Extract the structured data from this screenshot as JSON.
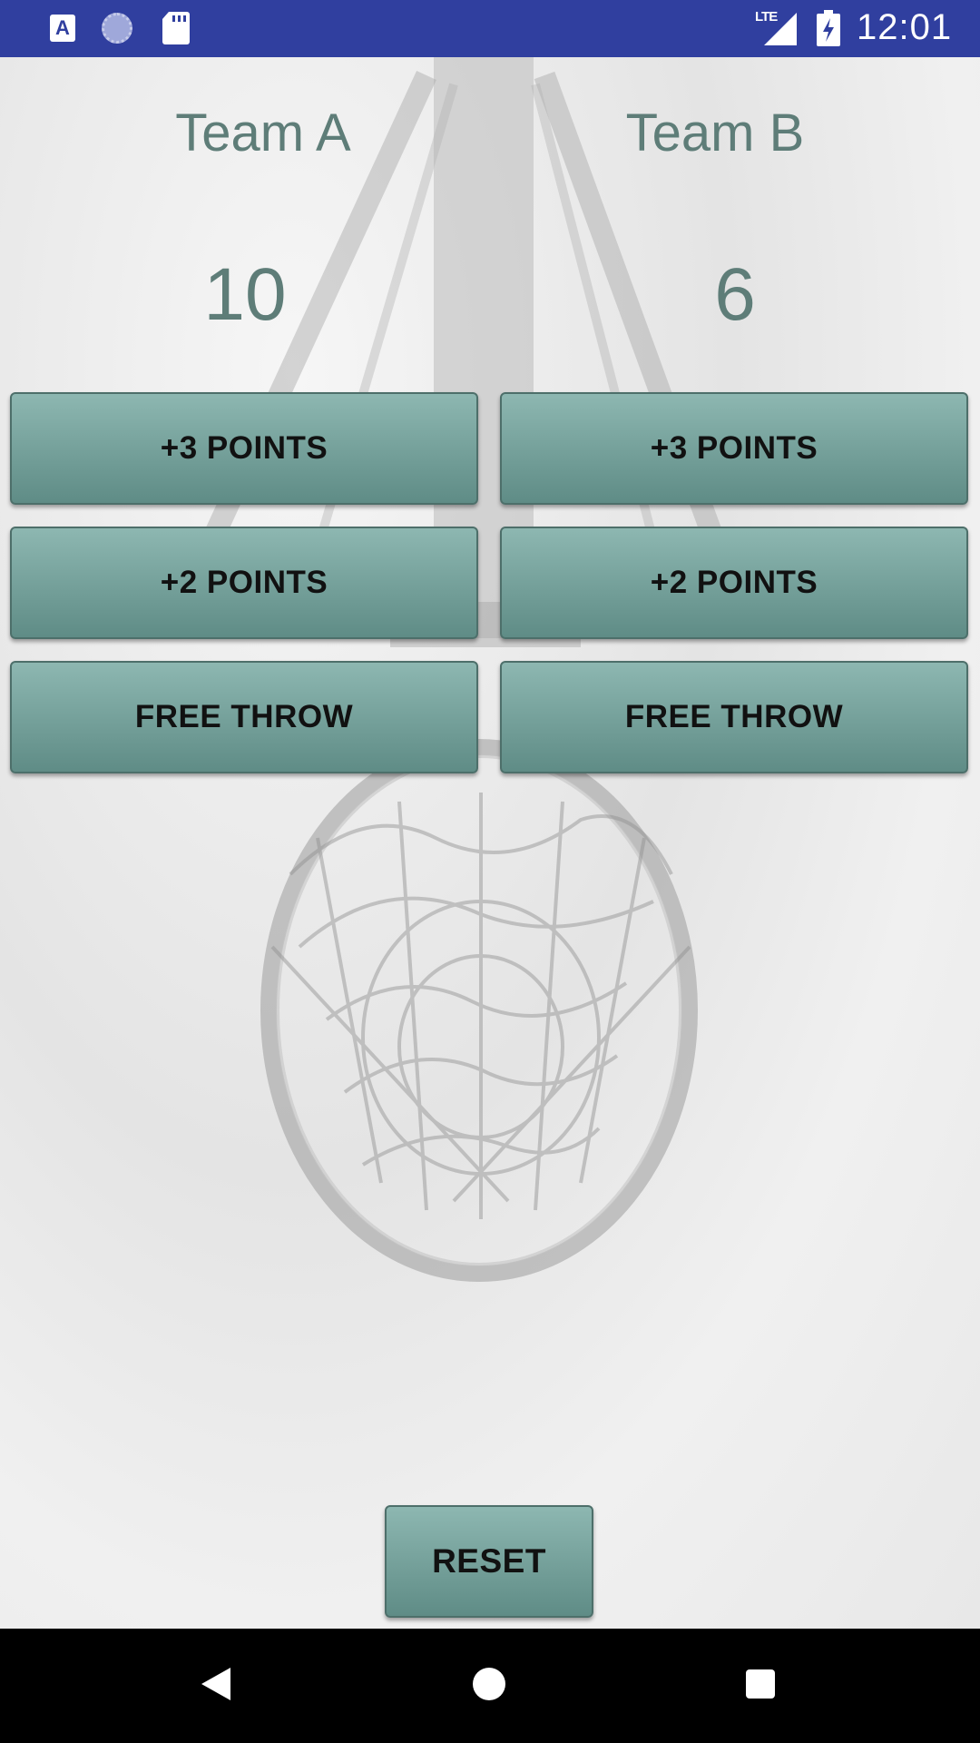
{
  "status_bar": {
    "time": "12:01",
    "network_label": "LTE",
    "notification_icons": [
      "app-a-icon",
      "sync-icon",
      "sd-card-icon"
    ],
    "system_icons": [
      "signal-icon",
      "battery-charging-icon"
    ],
    "app_icon_letter": "A",
    "color": "#303f9f"
  },
  "team_a": {
    "name": "Team A",
    "score": "10",
    "buttons": {
      "three": "+3 POINTS",
      "two": "+2 POINTS",
      "free_throw": "FREE THROW"
    }
  },
  "team_b": {
    "name": "Team B",
    "score": "6",
    "buttons": {
      "three": "+3 POINTS",
      "two": "+2 POINTS",
      "free_throw": "FREE THROW"
    }
  },
  "reset_label": "RESET",
  "colors": {
    "button_top": "#8db7b1",
    "button_bottom": "#5f8c86",
    "text_accent": "#5e7d78"
  },
  "nav_bar": {
    "icons": [
      "back-icon",
      "home-icon",
      "recents-icon"
    ]
  }
}
